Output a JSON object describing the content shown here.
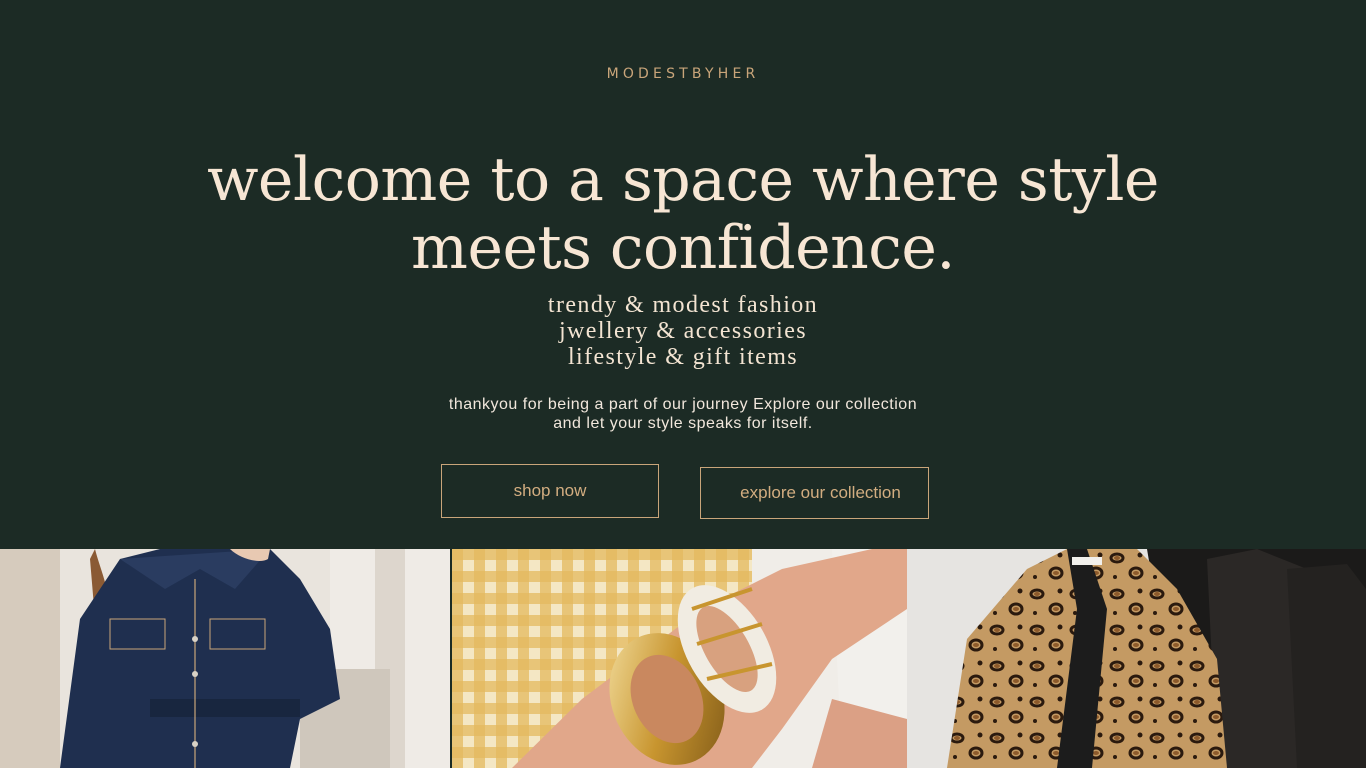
{
  "brand": {
    "name": "MODESTBYHER"
  },
  "hero": {
    "headline_lines": [
      "welcome to a space where style",
      "meets confidence."
    ],
    "tagline_lines": [
      "trendy & modest fashion",
      "jwellery & accessories",
      "lifestyle & gift items"
    ],
    "blurb_lines": [
      "thankyou for being a part of our journey Explore our collection",
      "and let your style speaks for itself."
    ]
  },
  "buttons": {
    "shop": "shop now",
    "explore": "explore our collection"
  },
  "gallery": {
    "tiles": [
      {
        "subject": "denim-outfit-photo"
      },
      {
        "subject": "bangles-photo"
      },
      {
        "subject": "leopard-coat-photo"
      }
    ]
  },
  "colors": {
    "background": "#1c2b25",
    "accent": "#c9a57a",
    "headline": "#f7e6d4"
  }
}
